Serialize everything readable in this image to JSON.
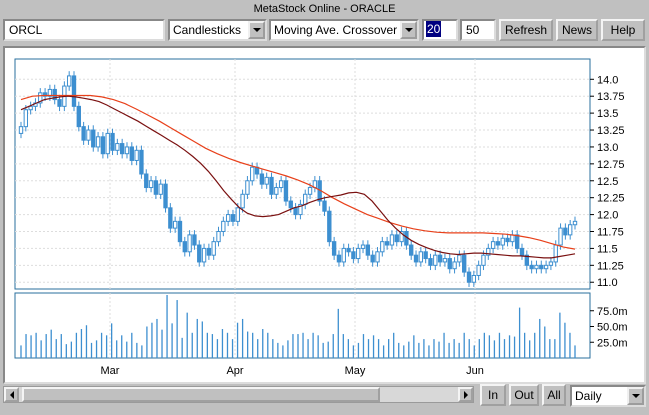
{
  "window": {
    "title": "MetaStock Online - ORACLE"
  },
  "toolbar": {
    "symbol": "ORCL",
    "chart_type": "Candlesticks",
    "indicator": "Moving Ave. Crossover",
    "period_short": "20",
    "period_long": "50",
    "refresh_label": "Refresh",
    "news_label": "News",
    "help_label": "Help"
  },
  "bottom": {
    "in_label": "In",
    "out_label": "Out",
    "all_label": "All",
    "interval": "Daily"
  },
  "colors": {
    "candle": "#3d8fd0",
    "ma_short": "#7a1010",
    "ma_long": "#e8401a",
    "volume": "#3d8fd0",
    "frame": "#2a6f9e"
  },
  "chart_data": [
    {
      "type": "candlestick",
      "title": "",
      "x_tick_labels": [
        "Mar",
        "Apr",
        "May",
        "Jun"
      ],
      "y_tick_labels": [
        "14.0",
        "13.75",
        "13.5",
        "13.25",
        "13.0",
        "12.75",
        "12.5",
        "12.25",
        "12.0",
        "11.75",
        "11.5",
        "11.25",
        "11.0"
      ],
      "ylim": [
        10.9,
        14.3
      ],
      "grid": true,
      "close": [
        13.3,
        13.55,
        13.6,
        13.65,
        13.8,
        13.75,
        13.85,
        13.7,
        13.6,
        13.9,
        14.05,
        13.6,
        13.3,
        13.1,
        13.25,
        13.0,
        13.15,
        12.9,
        13.2,
        12.95,
        13.05,
        12.9,
        13.0,
        12.8,
        12.95,
        12.6,
        12.4,
        12.5,
        12.3,
        12.45,
        12.1,
        11.8,
        11.9,
        11.6,
        11.45,
        11.7,
        11.55,
        11.3,
        11.5,
        11.4,
        11.6,
        11.75,
        11.9,
        12.0,
        11.9,
        12.1,
        12.3,
        12.5,
        12.7,
        12.6,
        12.45,
        12.55,
        12.3,
        12.4,
        12.5,
        12.2,
        12.1,
        12.0,
        12.15,
        12.3,
        12.4,
        12.5,
        12.2,
        12.05,
        11.6,
        11.4,
        11.3,
        11.5,
        11.45,
        11.35,
        11.5,
        11.55,
        11.4,
        11.3,
        11.45,
        11.6,
        11.55,
        11.7,
        11.6,
        11.75,
        11.55,
        11.4,
        11.3,
        11.45,
        11.35,
        11.25,
        11.4,
        11.3,
        11.35,
        11.2,
        11.3,
        11.4,
        11.15,
        11.0,
        11.1,
        11.25,
        11.4,
        11.5,
        11.6,
        11.55,
        11.65,
        11.6,
        11.7,
        11.5,
        11.4,
        11.25,
        11.2,
        11.25,
        11.2,
        11.25,
        11.3,
        11.55,
        11.8,
        11.7,
        11.85,
        11.9
      ],
      "ma_short": [
        13.55,
        13.6,
        13.65,
        13.7,
        13.72,
        13.74,
        13.75,
        13.74,
        13.72,
        13.7,
        13.67,
        13.62,
        13.56,
        13.5,
        13.44,
        13.38,
        13.31,
        13.24,
        13.17,
        13.1,
        13.03,
        12.95,
        12.86,
        12.76,
        12.64,
        12.5,
        12.35,
        12.22,
        12.1,
        12.02,
        11.98,
        11.97,
        11.98,
        12.0,
        12.05,
        12.1,
        12.13,
        12.18,
        12.22,
        12.25,
        12.27,
        12.29,
        12.32,
        12.33,
        12.3,
        12.2,
        12.06,
        11.92,
        11.8,
        11.7,
        11.62,
        11.56,
        11.51,
        11.47,
        11.44,
        11.42,
        11.41,
        11.42,
        11.43,
        11.43,
        11.42,
        11.41,
        11.4,
        11.39,
        11.39,
        11.38,
        11.37,
        11.36,
        11.36,
        11.38,
        11.4,
        11.42
      ],
      "ma_long": [
        13.7,
        13.75,
        13.76,
        13.76,
        13.76,
        13.76,
        13.76,
        13.74,
        13.7,
        13.64,
        13.56,
        13.47,
        13.38,
        13.28,
        13.18,
        13.08,
        12.98,
        12.9,
        12.83,
        12.77,
        12.72,
        12.67,
        12.62,
        12.57,
        12.51,
        12.44,
        12.35,
        12.25,
        12.16,
        12.08,
        12.0,
        11.94,
        11.88,
        11.83,
        11.79,
        11.76,
        11.74,
        11.73,
        11.73,
        11.73,
        11.73,
        11.72,
        11.71,
        11.69,
        11.66,
        11.62,
        11.57,
        11.52,
        11.49
      ]
    },
    {
      "type": "bar",
      "title": "",
      "y_tick_labels": [
        "75.0m",
        "50.0m",
        "25.0m"
      ],
      "ylim": [
        0,
        100
      ],
      "values": [
        20,
        38,
        36,
        40,
        28,
        38,
        45,
        30,
        38,
        22,
        26,
        40,
        46,
        52,
        24,
        28,
        40,
        36,
        55,
        28,
        36,
        26,
        40,
        24,
        20,
        50,
        56,
        62,
        45,
        100,
        55,
        92,
        32,
        72,
        40,
        62,
        58,
        40,
        38,
        30,
        46,
        40,
        30,
        56,
        62,
        42,
        40,
        30,
        46,
        40,
        30,
        24,
        20,
        28,
        38,
        38,
        40,
        30,
        40,
        36,
        24,
        26,
        38,
        78,
        38,
        30,
        20,
        24,
        38,
        30,
        36,
        30,
        20,
        30,
        40,
        24,
        20,
        26,
        36,
        24,
        30,
        20,
        30,
        26,
        40,
        24,
        30,
        24,
        40,
        30,
        20,
        30,
        40,
        36,
        28,
        40,
        30,
        36,
        34,
        80,
        40,
        28,
        40,
        62,
        50,
        30,
        30,
        72,
        56,
        40,
        20
      ]
    }
  ]
}
